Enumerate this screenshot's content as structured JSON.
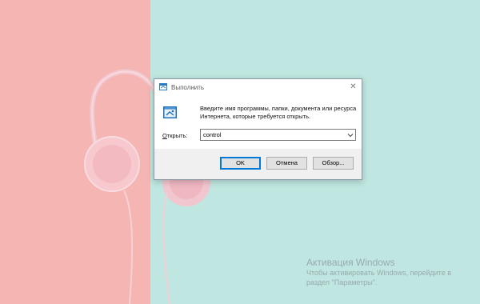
{
  "run_dialog": {
    "title": "Выполнить",
    "close_glyph": "✕",
    "description": "Введите имя программы, папки, документа или ресурса Интернета, которые требуется открыть.",
    "open_label_first": "О",
    "open_label_rest": "ткрыть:",
    "open_value": "control",
    "buttons": {
      "ok": "OK",
      "cancel": "Отмена",
      "browse": "Обзор..."
    }
  },
  "watermark": {
    "title": "Активация Windows",
    "line1": "Чтобы активировать Windows, перейдите в",
    "line2": "раздел \"Параметры\"."
  },
  "icons": {
    "run": "run-app-icon",
    "close": "close-icon",
    "dropdown": "chevron-down-icon"
  },
  "colors": {
    "wallpaper_pink": "#f5b5b3",
    "wallpaper_mint": "#bfe6e0",
    "accent": "#0078d7"
  }
}
